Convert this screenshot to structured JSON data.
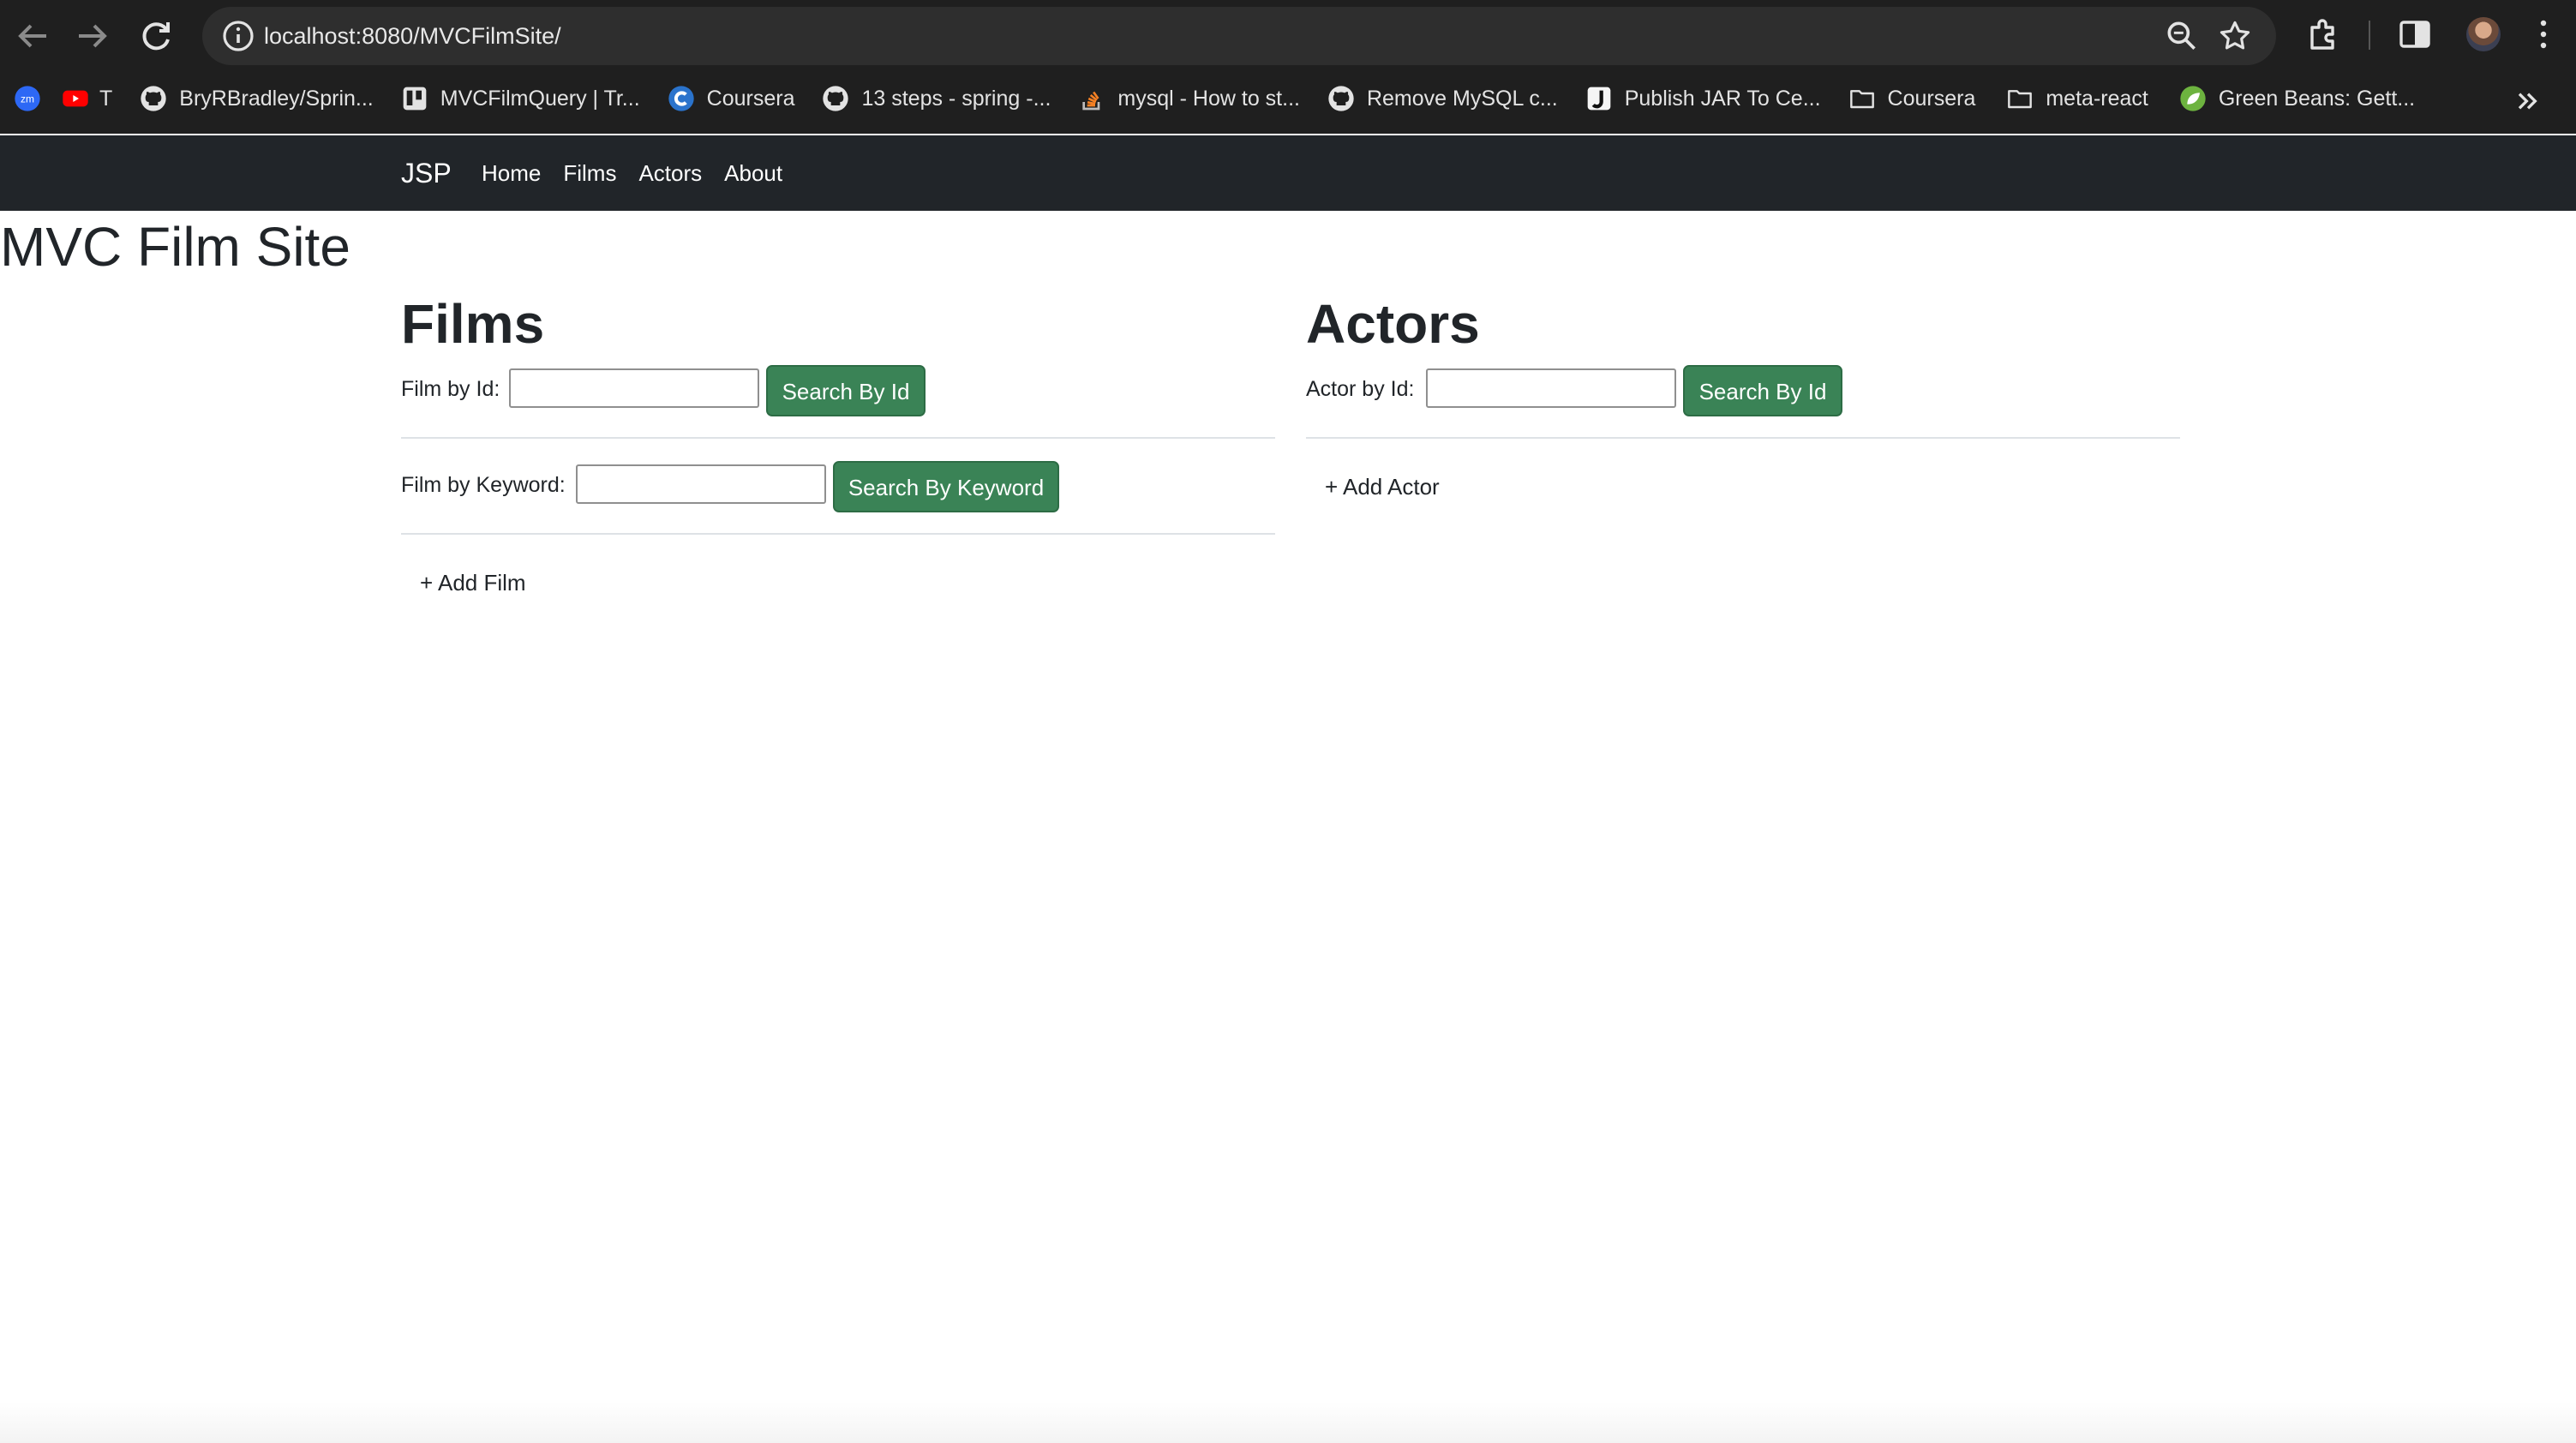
{
  "browser": {
    "url": "localhost:8080/MVCFilmSite/",
    "bookmarks": [
      {
        "label": "",
        "icon": "zoom-icon"
      },
      {
        "label": "T",
        "icon": "youtube-icon"
      },
      {
        "label": "BryRBradley/Sprin...",
        "icon": "github-icon"
      },
      {
        "label": "MVCFilmQuery | Tr...",
        "icon": "trello-icon"
      },
      {
        "label": "Coursera",
        "icon": "coursera-icon"
      },
      {
        "label": "13 steps - spring -...",
        "icon": "github-icon"
      },
      {
        "label": "mysql - How to st...",
        "icon": "stackoverflow-icon"
      },
      {
        "label": "Remove MySQL c...",
        "icon": "github-icon"
      },
      {
        "label": "Publish JAR To Ce...",
        "icon": "j-icon"
      },
      {
        "label": "Coursera",
        "icon": "folder-icon"
      },
      {
        "label": "meta-react",
        "icon": "folder-icon"
      },
      {
        "label": "Green Beans: Gett...",
        "icon": "spring-icon"
      }
    ]
  },
  "navbar": {
    "brand": "JSP",
    "links": [
      "Home",
      "Films",
      "Actors",
      "About"
    ]
  },
  "page": {
    "title": "MVC Film Site",
    "films": {
      "heading": "Films",
      "id_label": "Film by Id:",
      "id_value": "",
      "id_button": "Search By Id",
      "keyword_label": "Film by Keyword:",
      "keyword_value": "",
      "keyword_button": "Search By Keyword",
      "add_link": "+ Add Film"
    },
    "actors": {
      "heading": "Actors",
      "id_label": "Actor by Id:",
      "id_value": "",
      "id_button": "Search By Id",
      "add_link": "+ Add Actor"
    }
  },
  "colors": {
    "navbar_bg": "#212529",
    "button_green": "#3a8356",
    "browser_bg": "#1f1f1f"
  }
}
